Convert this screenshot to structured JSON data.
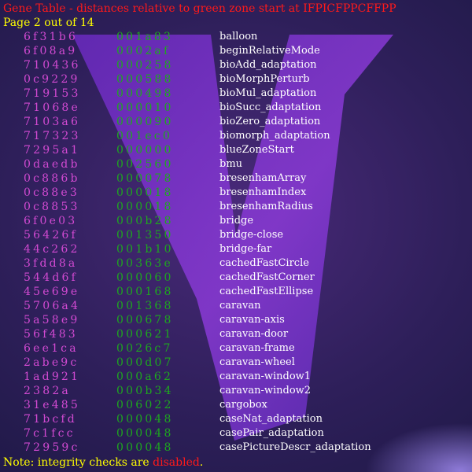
{
  "header": {
    "title": "Gene Table - distances relative to green zone start at IFPICFPPCFFPP",
    "page_indicator": "Page 2 out of 14"
  },
  "table": {
    "rows": [
      {
        "hash": "6f31b6",
        "distance": "001a83",
        "name": "balloon"
      },
      {
        "hash": "6f08a9",
        "distance": "0002af",
        "name": "beginRelativeMode"
      },
      {
        "hash": "710436",
        "distance": "000258",
        "name": "bioAdd_adaptation"
      },
      {
        "hash": "0c9229",
        "distance": "000588",
        "name": "bioMorphPerturb"
      },
      {
        "hash": "719153",
        "distance": "000498",
        "name": "bioMul_adaptation"
      },
      {
        "hash": "71068e",
        "distance": "000010",
        "name": "bioSucc_adaptation"
      },
      {
        "hash": "7103a6",
        "distance": "000090",
        "name": "bioZero_adaptation"
      },
      {
        "hash": "717323",
        "distance": "001ec0",
        "name": "biomorph_adaptation"
      },
      {
        "hash": "7295a1",
        "distance": "000000",
        "name": "blueZoneStart"
      },
      {
        "hash": "0daedb",
        "distance": "002560",
        "name": "bmu"
      },
      {
        "hash": "0c886b",
        "distance": "000078",
        "name": "bresenhamArray"
      },
      {
        "hash": "0c88e3",
        "distance": "000018",
        "name": "bresenhamIndex"
      },
      {
        "hash": "0c8853",
        "distance": "000018",
        "name": "bresenhamRadius"
      },
      {
        "hash": "6f0e03",
        "distance": "000b28",
        "name": "bridge"
      },
      {
        "hash": "56426f",
        "distance": "001350",
        "name": "bridge-close"
      },
      {
        "hash": "44c262",
        "distance": "001b10",
        "name": "bridge-far"
      },
      {
        "hash": "3fdd8a",
        "distance": "00363e",
        "name": "cachedFastCircle"
      },
      {
        "hash": "544d6f",
        "distance": "000060",
        "name": "cachedFastCorner"
      },
      {
        "hash": "45e69e",
        "distance": "000168",
        "name": "cachedFastEllipse"
      },
      {
        "hash": "5706a4",
        "distance": "001368",
        "name": "caravan"
      },
      {
        "hash": "5a58e9",
        "distance": "000678",
        "name": "caravan-axis"
      },
      {
        "hash": "56f483",
        "distance": "000621",
        "name": "caravan-door"
      },
      {
        "hash": "6ee1ca",
        "distance": "0026c7",
        "name": "caravan-frame"
      },
      {
        "hash": "2abe9c",
        "distance": "000d07",
        "name": "caravan-wheel"
      },
      {
        "hash": "1ad921",
        "distance": "000a62",
        "name": "caravan-window1"
      },
      {
        "hash": "2382a",
        "distance": "000b34",
        "name": "caravan-window2"
      },
      {
        "hash": "31e485",
        "distance": "006022",
        "name": "cargobox"
      },
      {
        "hash": "71bcfd",
        "distance": "000048",
        "name": "caseNat_adaptation"
      },
      {
        "hash": "7c1fcc",
        "distance": "000048",
        "name": "casePair_adaptation"
      },
      {
        "hash": "72959c",
        "distance": "000048",
        "name": "casePictureDescr_adaptation"
      }
    ]
  },
  "footer": {
    "note_prefix": "Note: integrity checks are ",
    "note_state": "disabled",
    "note_suffix": "."
  },
  "colors": {
    "title": "#ff1a1a",
    "page_indicator": "#ffff00",
    "hash_column": "#d24ad2",
    "distance_column": "#1ea81e",
    "name_column": "#ffffff",
    "background": "#2e1f5a",
    "watermark": "#8a3ad6"
  }
}
